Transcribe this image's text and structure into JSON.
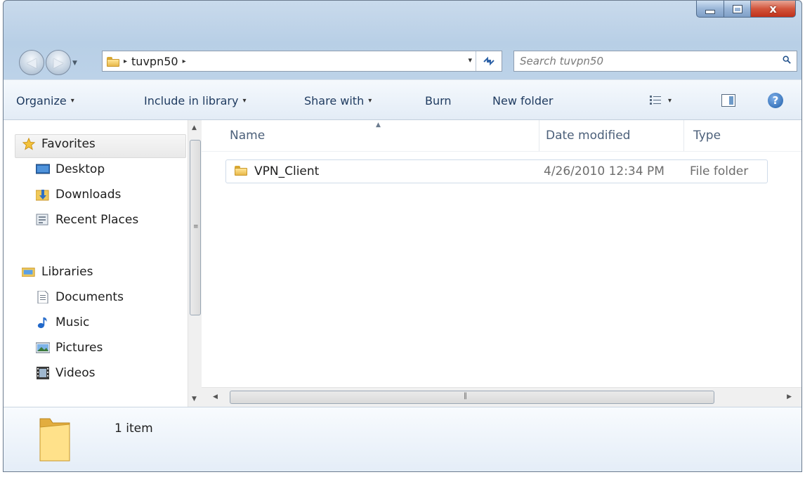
{
  "window": {
    "caption": {
      "close_glyph": "x"
    }
  },
  "address_bar": {
    "crumb": "tuvpn50",
    "separator": "▸",
    "dropdown": "▾",
    "refresh_icon": "refresh-icon"
  },
  "search": {
    "placeholder": "Search tuvpn50"
  },
  "commands": {
    "organize": "Organize",
    "include_in_library": "Include in library",
    "share_with": "Share with",
    "burn": "Burn",
    "new_folder": "New folder",
    "dropdown": "▾",
    "help": "?"
  },
  "navigation_pane": {
    "favorites": {
      "label": "Favorites",
      "items": [
        {
          "label": "Desktop",
          "icon": "desktop-icon"
        },
        {
          "label": "Downloads",
          "icon": "downloads-icon"
        },
        {
          "label": "Recent Places",
          "icon": "recent-places-icon"
        }
      ]
    },
    "libraries": {
      "label": "Libraries",
      "items": [
        {
          "label": "Documents",
          "icon": "documents-icon"
        },
        {
          "label": "Music",
          "icon": "music-icon"
        },
        {
          "label": "Pictures",
          "icon": "pictures-icon"
        },
        {
          "label": "Videos",
          "icon": "videos-icon"
        }
      ]
    }
  },
  "file_list": {
    "columns": {
      "name": "Name",
      "date_modified": "Date modified",
      "type": "Type"
    },
    "rows": [
      {
        "name": "VPN_Client",
        "date_modified": "4/26/2010 12:34 PM",
        "type": "File folder"
      }
    ]
  },
  "details_pane": {
    "count": "1 item"
  },
  "colors": {
    "frame": "#bcd2e8",
    "accent_link": "#1e3a5f",
    "folder_yellow": "#e8b84a",
    "close_red": "#c0311b"
  }
}
